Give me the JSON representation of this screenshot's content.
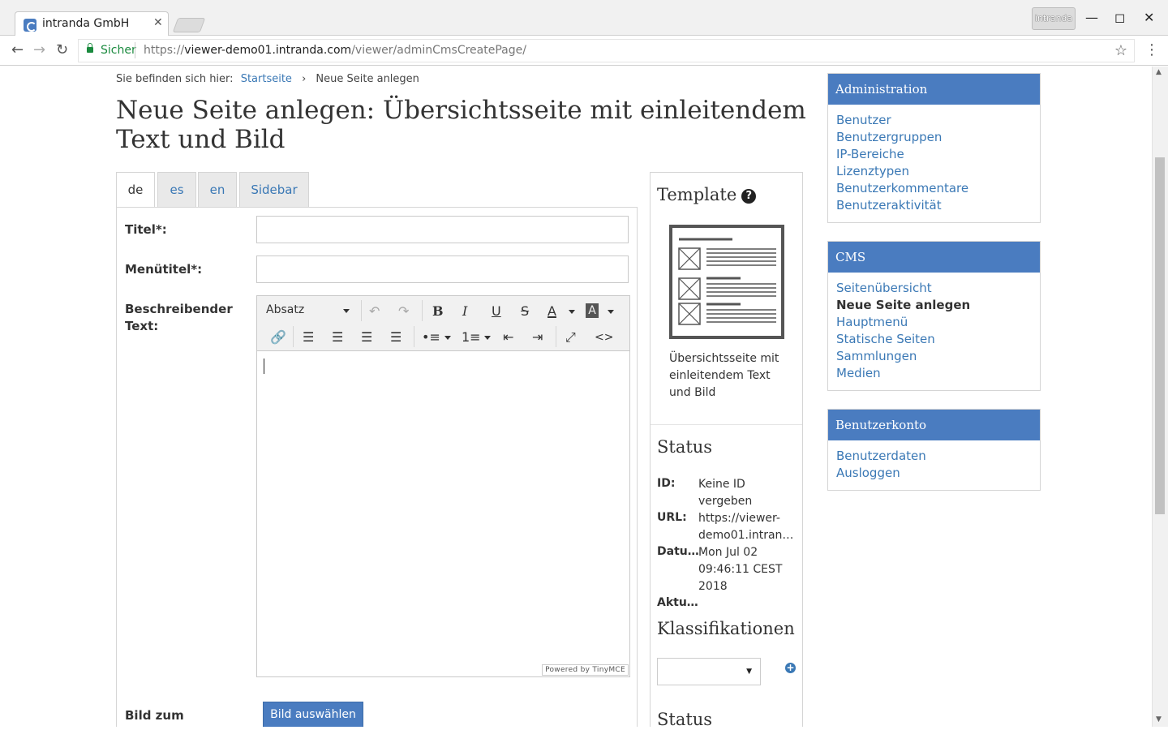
{
  "browser": {
    "tab_title": "intranda GmbH",
    "profile_label": "intranda",
    "secure_label": "Sicher",
    "url_scheme": "https://",
    "url_host": "viewer-demo01.intranda.com",
    "url_path": "/viewer/adminCmsCreatePage/"
  },
  "breadcrumb": {
    "prefix": "Sie befinden sich hier:",
    "home": "Startseite",
    "separator": "›",
    "current": "Neue Seite anlegen"
  },
  "page_title": "Neue Seite anlegen: Übersichtsseite mit einleitendem Text und Bild",
  "language_tabs": [
    "de",
    "es",
    "en",
    "Sidebar"
  ],
  "form": {
    "title_label": "Titel*:",
    "title_value": "",
    "menu_title_label": "Menütitel*:",
    "menu_title_value": "",
    "description_label_line1": "Beschreibender",
    "description_label_line2": "Text:",
    "editor_format": "Absatz",
    "powered_by": "Powered by TinyMCE",
    "image_label": "Bild zum",
    "image_button": "Bild auswählen"
  },
  "template": {
    "heading": "Template",
    "description": "Übersichtsseite mit einleitendem Text und Bild"
  },
  "status": {
    "heading": "Status",
    "id_key": "ID:",
    "id_value": "Keine ID vergeben",
    "url_key": "URL:",
    "url_value_line1": "https://viewer-",
    "url_value_line2": "demo01.intran…",
    "date_key": "Datu…",
    "date_value": "Mon Jul 02 09:46:11 CEST 2018",
    "updated_key": "Aktu…",
    "classifications_heading": "Klassifikationen",
    "classification_selected": "",
    "status_heading_2": "Status"
  },
  "sidebar": {
    "admin": {
      "title": "Administration",
      "items": [
        "Benutzer",
        "Benutzergruppen",
        "IP-Bereiche",
        "Lizenztypen",
        "Benutzerkommentare",
        "Benutzeraktivität"
      ]
    },
    "cms": {
      "title": "CMS",
      "items": [
        "Seitenübersicht",
        "Neue Seite anlegen",
        "Hauptmenü",
        "Statische Seiten",
        "Sammlungen",
        "Medien"
      ]
    },
    "account": {
      "title": "Benutzerkonto",
      "items": [
        "Benutzerdaten",
        "Ausloggen"
      ]
    }
  },
  "colors": {
    "brand_blue": "#4a7cc0",
    "link_blue": "#3a78b5",
    "secure_green": "#1a8a3e"
  }
}
